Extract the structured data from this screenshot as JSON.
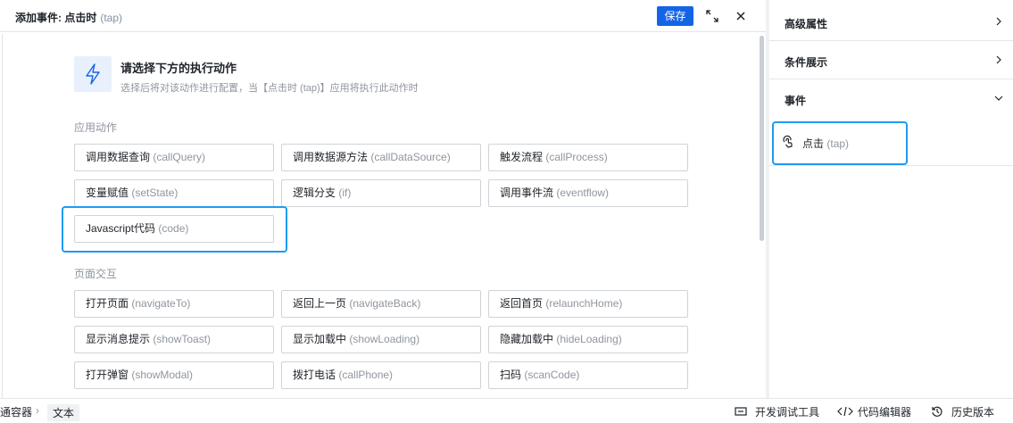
{
  "header": {
    "title": "添加事件: 点击时",
    "title_sub": "(tap)",
    "save_label": "保存"
  },
  "intro": {
    "title": "请选择下方的执行动作",
    "desc": "选择后将对该动作进行配置，当【点击时 (tap)】应用将执行此动作时"
  },
  "sections": {
    "app": "应用动作",
    "page": "页面交互"
  },
  "app_actions": [
    {
      "zh": "调用数据查询",
      "en": "(callQuery)"
    },
    {
      "zh": "调用数据源方法",
      "en": "(callDataSource)"
    },
    {
      "zh": "触发流程",
      "en": "(callProcess)"
    },
    {
      "zh": "变量赋值",
      "en": "(setState)"
    },
    {
      "zh": "逻辑分支",
      "en": "(if)"
    },
    {
      "zh": "调用事件流",
      "en": "(eventflow)"
    },
    {
      "zh": "Javascript代码",
      "en": "(code)"
    }
  ],
  "page_actions": [
    {
      "zh": "打开页面",
      "en": "(navigateTo)"
    },
    {
      "zh": "返回上一页",
      "en": "(navigateBack)"
    },
    {
      "zh": "返回首页",
      "en": "(relaunchHome)"
    },
    {
      "zh": "显示消息提示",
      "en": "(showToast)"
    },
    {
      "zh": "显示加载中",
      "en": "(showLoading)"
    },
    {
      "zh": "隐藏加载中",
      "en": "(hideLoading)"
    },
    {
      "zh": "打开弹窗",
      "en": "(showModal)"
    },
    {
      "zh": "拨打电话",
      "en": "(callPhone)"
    },
    {
      "zh": "扫码",
      "en": "(scanCode)"
    }
  ],
  "right_panel": {
    "advanced": "高级属性",
    "conditional": "条件展示",
    "events": "事件",
    "event_item_zh": "点击",
    "event_item_en": "(tap)"
  },
  "footer": {
    "crumb_parent": "通容器",
    "crumb_current": "文本",
    "debug_tool": "开发调试工具",
    "code_editor": "代码编辑器",
    "history": "历史版本"
  },
  "colors": {
    "accent": "#1464e6",
    "highlight": "#1e9bf0"
  }
}
